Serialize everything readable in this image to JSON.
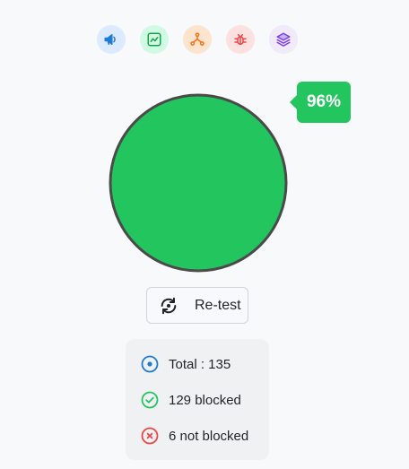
{
  "toolbar": {
    "icons": [
      {
        "name": "megaphone-icon",
        "color": "#1d7bd6",
        "bg": "#dbeafe"
      },
      {
        "name": "chart-line-icon",
        "color": "#16a34a",
        "bg": "#d1fae5"
      },
      {
        "name": "network-icon",
        "color": "#f97316",
        "bg": "#fde4cf"
      },
      {
        "name": "bug-icon",
        "color": "#ef4444",
        "bg": "#fde0e0"
      },
      {
        "name": "layers-icon",
        "color": "#7c3aed",
        "bg": "#f0eafa"
      }
    ]
  },
  "gauge": {
    "percent": 0.96,
    "fill_color": "#22c55e",
    "stroke_color": "#4a4a4a",
    "label": "96%"
  },
  "retest": {
    "label": "Re-test",
    "icon": "refresh-icon"
  },
  "stats": {
    "total": {
      "label": "Total : 135",
      "icon": "target-icon",
      "color": "#1d7bd6"
    },
    "blocked": {
      "label": "129 blocked",
      "icon": "check-circle-icon",
      "color": "#22c55e"
    },
    "not_blocked": {
      "label": "6 not blocked",
      "icon": "x-circle-icon",
      "color": "#ef4444"
    }
  }
}
